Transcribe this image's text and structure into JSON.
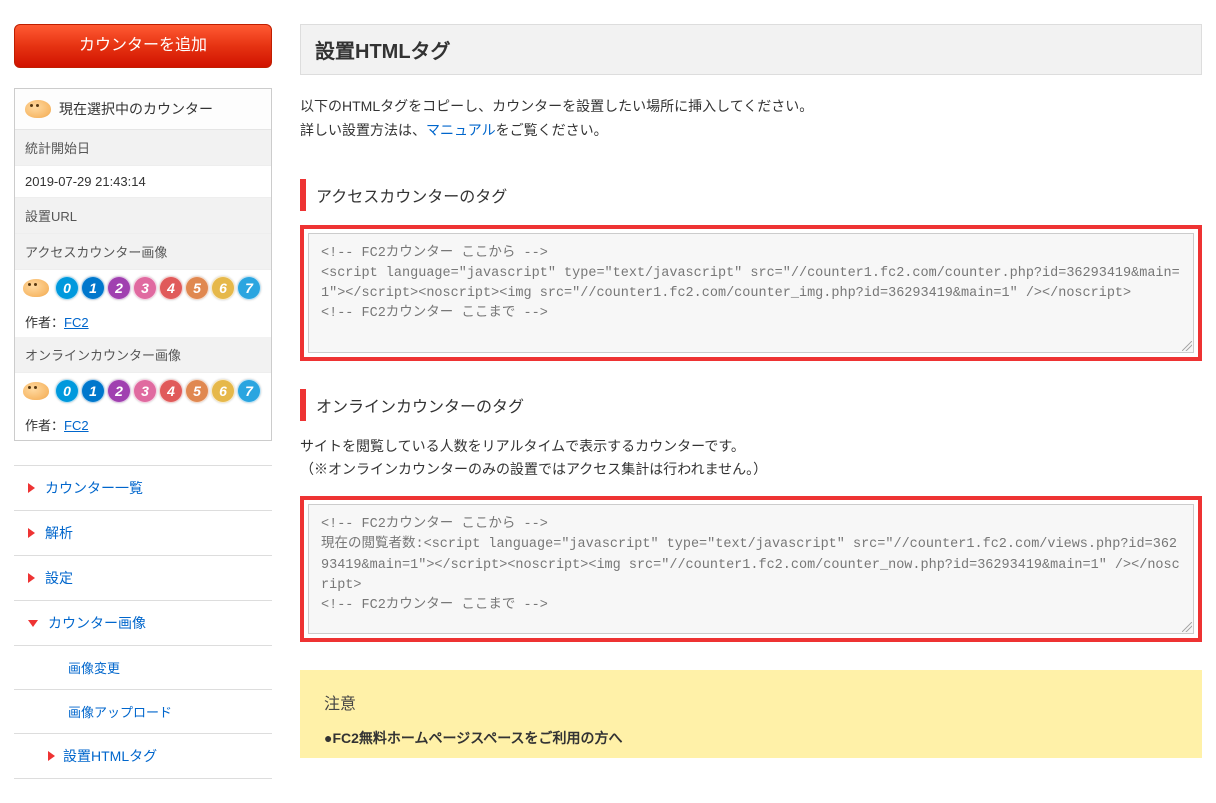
{
  "sidebar": {
    "add_button": "カウンターを追加",
    "panel_title": "現在選択中のカウンター",
    "stat_start_label": "統計開始日",
    "stat_start_value": "2019-07-29 21:43:14",
    "url_label": "設置URL",
    "access_image_label": "アクセスカウンター画像",
    "online_image_label": "オンラインカウンター画像",
    "author_label": "作者：",
    "author_link": "FC2",
    "digits": [
      "0",
      "1",
      "2",
      "3",
      "4",
      "5",
      "6",
      "7"
    ],
    "nav": {
      "list": "カウンター一覧",
      "analysis": "解析",
      "settings": "設定",
      "counter_image": "カウンター画像",
      "image_change": "画像変更",
      "image_upload": "画像アップロード",
      "html_tag": "設置HTMLタグ"
    }
  },
  "main": {
    "title": "設置HTMLタグ",
    "intro_line1": "以下のHTMLタグをコピーし、カウンターを設置したい場所に挿入してください。",
    "intro_line2_pre": "詳しい設置方法は、",
    "intro_link": "マニュアル",
    "intro_line2_post": "をご覧ください。",
    "section1_heading": "アクセスカウンターのタグ",
    "code1": "<!-- FC2カウンター ここから -->\n<script language=\"javascript\" type=\"text/javascript\" src=\"//counter1.fc2.com/counter.php?id=36293419&main=1\"></script><noscript><img src=\"//counter1.fc2.com/counter_img.php?id=36293419&main=1\" /></noscript>\n<!-- FC2カウンター ここまで -->",
    "section2_heading": "オンラインカウンターのタグ",
    "section2_desc1": "サイトを閲覧している人数をリアルタイムで表示するカウンターです。",
    "section2_desc2": "（※オンラインカウンターのみの設置ではアクセス集計は行われません。）",
    "code2": "<!-- FC2カウンター ここから -->\n現在の閲覧者数:<script language=\"javascript\" type=\"text/javascript\" src=\"//counter1.fc2.com/views.php?id=36293419&main=1\"></script><noscript><img src=\"//counter1.fc2.com/counter_now.php?id=36293419&main=1\" /></noscript>\n<!-- FC2カウンター ここまで -->",
    "notice_title": "注意",
    "notice_line1": "●FC2無料ホームページスペースをご利用の方へ"
  }
}
